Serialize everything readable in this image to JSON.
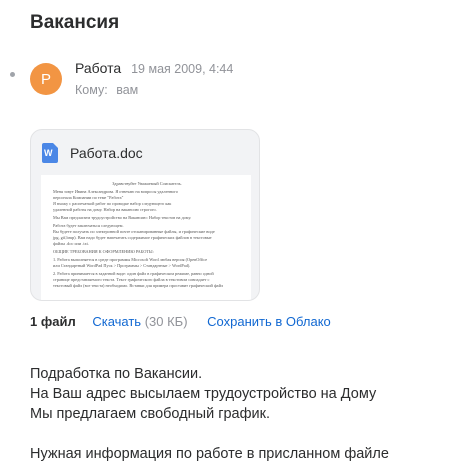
{
  "subject": "Вакансия",
  "sender": {
    "avatar_letter": "Р",
    "avatar_color": "#f29543",
    "name": "Работа",
    "date": "19 мая 2009, 4:44"
  },
  "recipient": {
    "label": "Кому:",
    "value": "вам"
  },
  "attachment": {
    "icon": "word-doc-icon",
    "icon_letter": "W",
    "file_name": "Работа.doc",
    "preview_lines": [
      "Здравствуйте Уважаемый Соискатель.",
      "Меня зовут Ивина Александрова. Я отвечаю на вопросы удаленного",
      "персонала Компании по теме \"Работа\"",
      "Я вхожу с распечаткой работ по проводке набор следующего как",
      "удаленной работы на дому. Набор на вакансию строгого.",
      "Мы Вам предлагаем трудоустройство на Вакансию: Набор текстов на дому.",
      "Работа будет заключаться следующем.",
      "Вы будете получать по электронной почте отсканированные файлы, и графические виде",
      "jpg, gif,bmp). Вам надо будет напечатать содержимое графических файлов в текстовые",
      "файлы .doc или .txt.",
      "ОБЩИЕ ТРЕБОВАНИЯ К ОФОРМЛЕНИЮ РАБОТЫ:",
      "1. Работа выполняется в среде программы Microsoft Word любая версия (OpenOffice",
      "или Стандартный WordPad Пуск > Программы > Стандартные > WordPad).",
      "2. Работа принимается в заданной виде: один файл в графическом режиме, равно одной",
      "странице представляемого текста. Текст графического файла в текстовом совпадает с",
      "текстовый файл (все текста) необходимо. Вставки для примера проставит графический файл"
    ],
    "count_label": "1 файл",
    "download_label": "Скачать",
    "download_size": "(30 КБ)",
    "cloud_label": "Сохранить в Облако"
  },
  "body": {
    "paragraph1": [
      "Подработка по Вакансии.",
      "На Ваш адрес высылаем трудоустройство на Дому",
      "Мы предлагаем свободный график."
    ],
    "paragraph2": "Нужная информация по работе в присланном файле"
  }
}
